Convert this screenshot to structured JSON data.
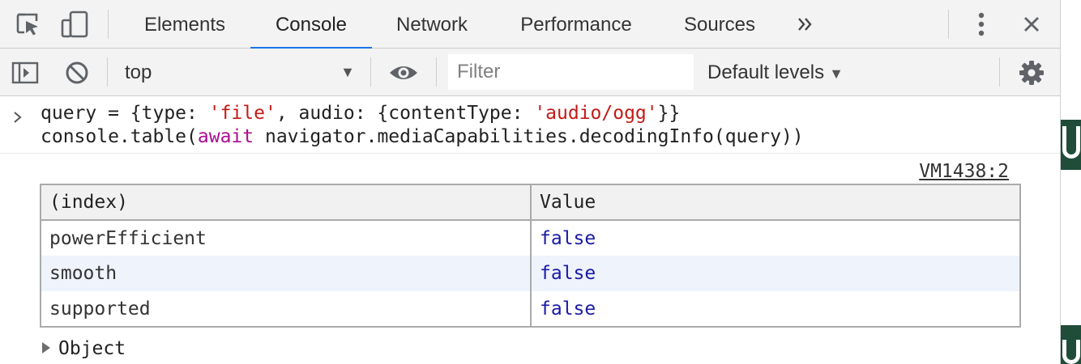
{
  "tabbar": {
    "tabs": [
      {
        "label": "Elements",
        "active": false
      },
      {
        "label": "Console",
        "active": true
      },
      {
        "label": "Network",
        "active": false
      },
      {
        "label": "Performance",
        "active": false
      },
      {
        "label": "Sources",
        "active": false
      }
    ],
    "more_tabs_icon": "double-chevron-right-icon",
    "icons": [
      "inspect-element-icon",
      "device-toolbar-icon",
      "kebab-menu-icon",
      "close-icon"
    ]
  },
  "console_toolbar": {
    "context": "top",
    "filter": {
      "value": "",
      "placeholder": "Filter"
    },
    "levels": "Default levels",
    "icons": [
      "sidebar-toggle-icon",
      "clear-console-icon",
      "eye-icon",
      "gear-icon"
    ]
  },
  "console": {
    "input_lines": [
      {
        "parts": [
          {
            "text": "query = {type: ",
            "kind": "plain"
          },
          {
            "text": "'file'",
            "kind": "string"
          },
          {
            "text": ", audio: {contentType: ",
            "kind": "plain"
          },
          {
            "text": "'audio/ogg'",
            "kind": "string"
          },
          {
            "text": "}}",
            "kind": "plain"
          }
        ]
      },
      {
        "parts": [
          {
            "text": "console.table(",
            "kind": "plain"
          },
          {
            "text": "await",
            "kind": "keyword"
          },
          {
            "text": " navigator.mediaCapabilities.decodingInfo(query))",
            "kind": "plain"
          }
        ]
      }
    ],
    "output": {
      "source": "VM1438:2",
      "table": {
        "headers": [
          "(index)",
          "Value"
        ],
        "rows": [
          {
            "index": "powerEfficient",
            "value": "false"
          },
          {
            "index": "smooth",
            "value": "false"
          },
          {
            "index": "supported",
            "value": "false"
          }
        ]
      },
      "object_label": "Object"
    }
  },
  "colors": {
    "accent": "#1a73e8",
    "string": "#c41a16",
    "keyword": "#aa0d91",
    "value": "#1a1aa6",
    "row_highlight": "#eef3fc",
    "page_edge": "#1f4d3a"
  }
}
